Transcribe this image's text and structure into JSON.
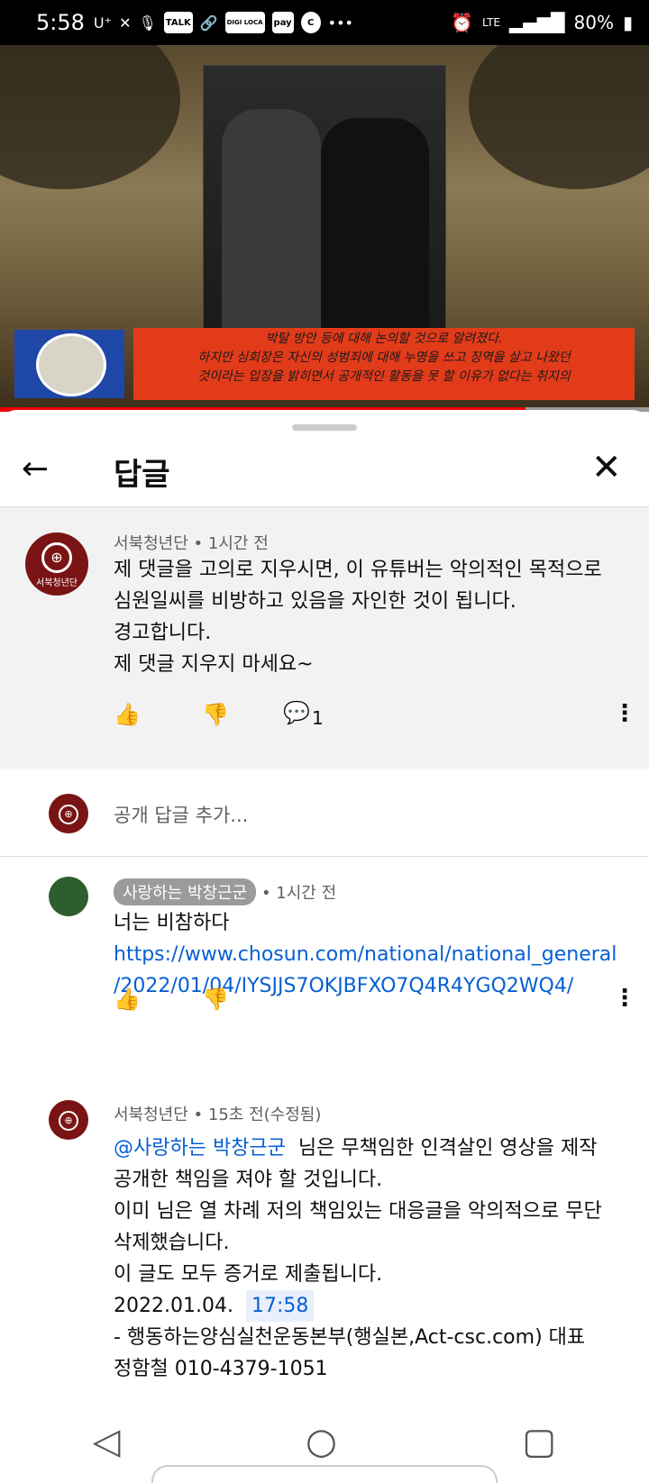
{
  "status_bar": {
    "time": "5:58",
    "carrier": "U⁺",
    "badges": [
      "TALK",
      "DIGI LOCA",
      "pay",
      "C"
    ],
    "network": "LTE",
    "battery": "80%"
  },
  "video": {
    "caption_lines": [
      "박탈 방안 등에 대해 논의할 것으로 알려졌다.",
      "하지만 심회장은 자신의 성범죄에 대해 누명을 쓰고 징역을 살고 나왔던",
      "것이라는 입장을 밝히면서 공개적인 활동을 못 할 이유가 없다는 취지의"
    ],
    "progress": 0.81
  },
  "header": {
    "title": "답글"
  },
  "parent_comment": {
    "author": "서북청년단",
    "time": "1시간 전",
    "logo_text": "서북청년단",
    "lines": [
      "제 댓글을 고의로 지우시면, 이 유튜버는 악의적인 목적으로",
      "심원일씨를 비방하고 있음을 자인한 것이 됩니다.",
      "경고합니다.",
      "제 댓글 지우지 마세요~"
    ],
    "reply_count": "1"
  },
  "add_reply": {
    "placeholder": "공개 답글 추가..."
  },
  "replies": [
    {
      "author": "사랑하는 박창근군",
      "time": "1시간 전",
      "text": "너는 비참하다",
      "link_lines": [
        "https://www.chosun.com/national/national_general",
        "/2022/01/04/IYSJJS7OKJBFXO7Q4R4YGQ2WQ4/"
      ]
    },
    {
      "author": "서북청년단",
      "time": "15초 전(수정됨)",
      "mention": "@사랑하는 박창근군",
      "line1_rest": "님은 무책임한 인격살인 영상을 제작",
      "lines": [
        "공개한 책임을 져야 할 것입니다.",
        "이미 님은 열 차례 저의 책임있는 대응글을 악의적으로 무단",
        "삭제했습니다.",
        "이 글도 모두 증거로 제출됩니다."
      ],
      "date": "2022.01.04.",
      "timestamp": "17:58",
      "sign_lines": [
        "- 행동하는양심실천운동본부(행실본,Act-csc.com) 대표",
        "정함철 010-4379-1051"
      ]
    }
  ],
  "separator": "•"
}
